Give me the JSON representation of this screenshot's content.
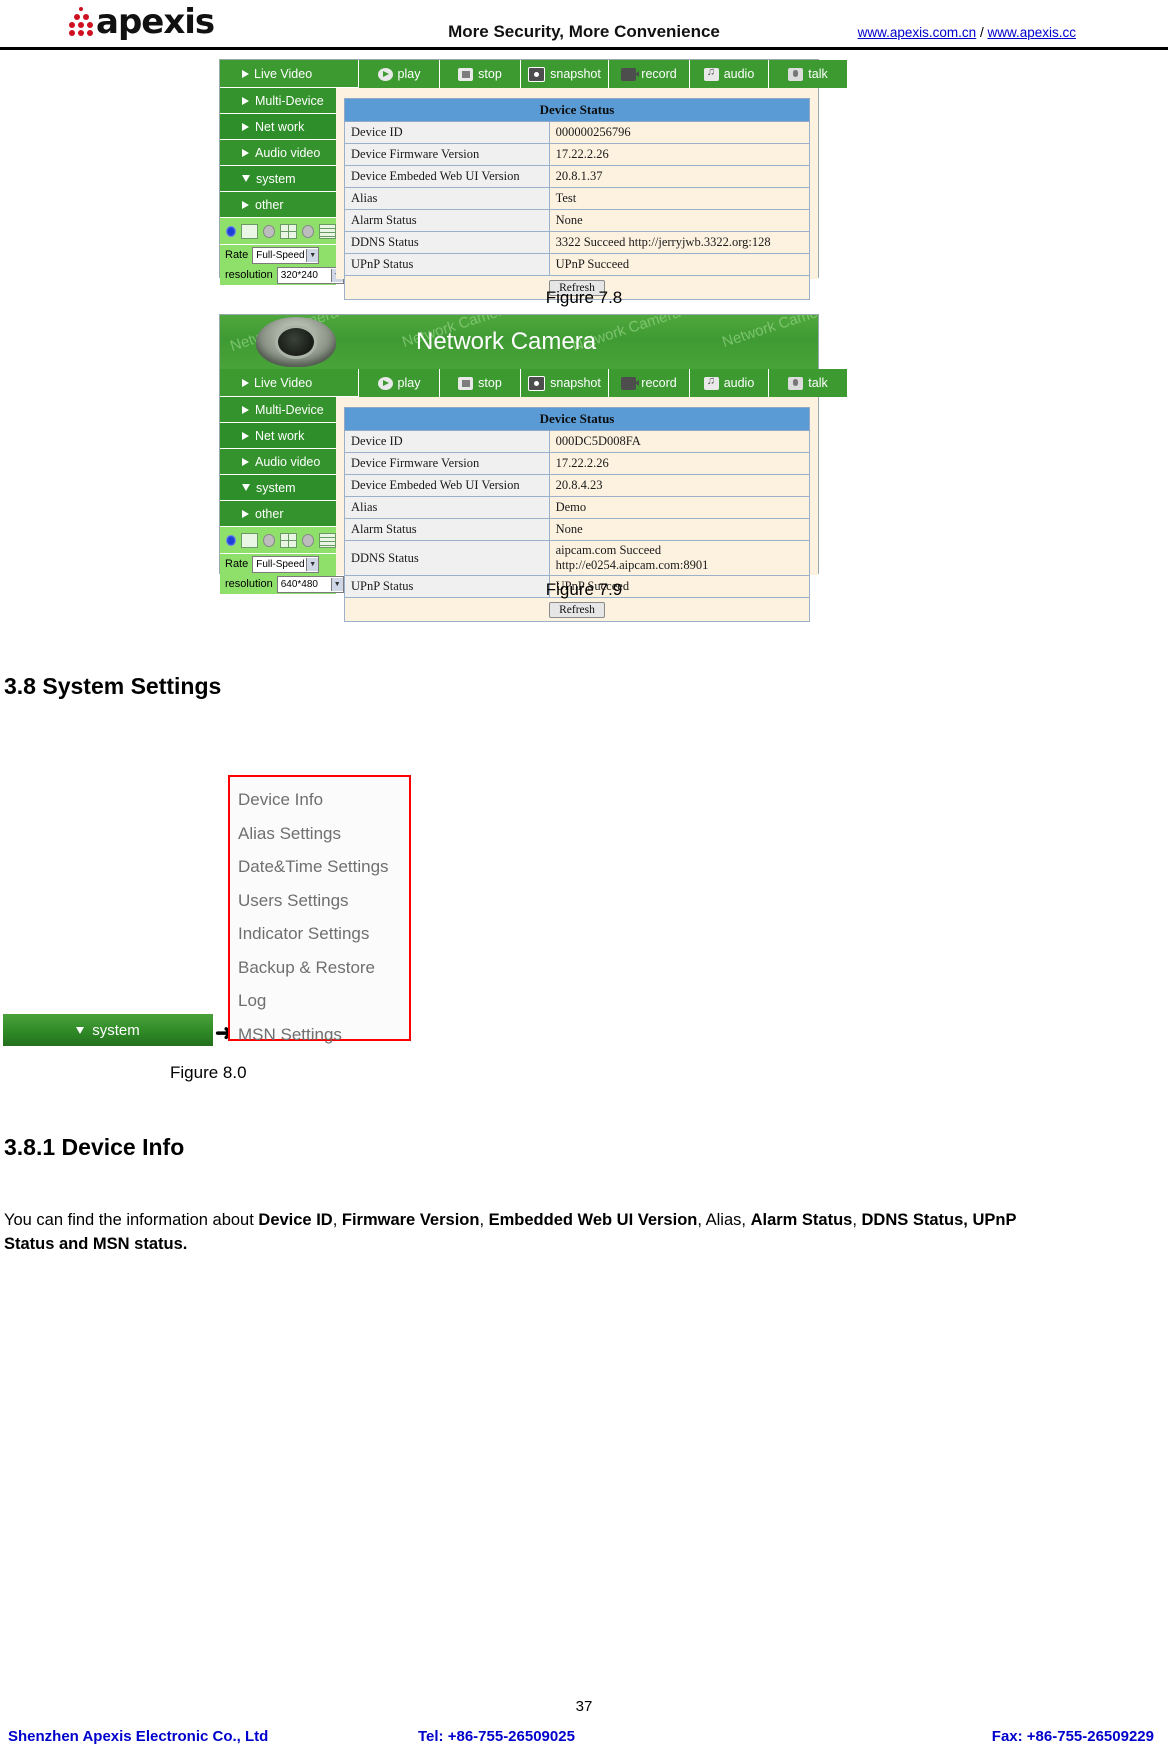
{
  "header": {
    "logo_text": "apexis",
    "tagline": "More Security, More Convenience",
    "link1": "www.apexis.com.cn",
    "separator": "/",
    "link2": "www.apexis.cc"
  },
  "figure78": {
    "caption": "Figure 7.8",
    "nav_items": [
      "Live Video",
      "Multi-Device",
      "Net work",
      "Audio video",
      "system",
      "other"
    ],
    "toolbar": [
      "play",
      "stop",
      "snapshot",
      "record",
      "audio",
      "talk"
    ],
    "rate_label": "Rate",
    "rate_value": "Full-Speed",
    "resolution_label": "resolution",
    "resolution_value": "320*240",
    "table_title": "Device Status",
    "rows": [
      {
        "key": "Device ID",
        "value": "000000256796"
      },
      {
        "key": "Device Firmware Version",
        "value": "17.22.2.26"
      },
      {
        "key": "Device Embeded Web UI Version",
        "value": "20.8.1.37"
      },
      {
        "key": "Alias",
        "value": "Test"
      },
      {
        "key": "Alarm Status",
        "value": "None"
      },
      {
        "key": "DDNS Status",
        "value": "3322 Succeed  http://jerryjwb.3322.org:128"
      },
      {
        "key": "UPnP Status",
        "value": "UPnP Succeed"
      }
    ],
    "refresh_label": "Refresh"
  },
  "figure79": {
    "caption": "Figure 7.9",
    "banner_title": "Network Camera",
    "watermark": "Network Camera",
    "nav_items": [
      "Live Video",
      "Multi-Device",
      "Net work",
      "Audio video",
      "system",
      "other"
    ],
    "toolbar": [
      "play",
      "stop",
      "snapshot",
      "record",
      "audio",
      "talk"
    ],
    "rate_label": "Rate",
    "rate_value": "Full-Speed",
    "resolution_label": "resolution",
    "resolution_value": "640*480",
    "table_title": "Device Status",
    "rows": [
      {
        "key": "Device ID",
        "value": "000DC5D008FA"
      },
      {
        "key": "Device Firmware Version",
        "value": "17.22.2.26"
      },
      {
        "key": "Device Embeded Web UI Version",
        "value": "20.8.4.23"
      },
      {
        "key": "Alias",
        "value": "Demo"
      },
      {
        "key": "Alarm Status",
        "value": "None"
      },
      {
        "key": "DDNS Status",
        "value": "aipcam.com  Succeed  http://e0254.aipcam.com:8901"
      },
      {
        "key": "UPnP Status",
        "value": "UPnP Succeed"
      }
    ],
    "refresh_label": "Refresh"
  },
  "section": {
    "heading_38": "3.8 System Settings",
    "heading_381": "3.8.1 Device Info",
    "figure80_caption": "Figure 8.0",
    "system_button_label": "system",
    "arrow_glyph": "➜",
    "menu_items": [
      "Device Info",
      "Alias Settings",
      "Date&Time Settings",
      "Users Settings",
      "Indicator Settings",
      "Backup & Restore",
      "Log",
      "MSN Settings"
    ],
    "body_part1": "You can find the information about ",
    "body_b1": "Device ID",
    "body_sep1": ", ",
    "body_b2": "Firmware Version",
    "body_sep2": ", ",
    "body_b3": "Embedded Web UI Version",
    "body_sep3": ", Alias, ",
    "body_b4": "Alarm Status",
    "body_sep4": ", ",
    "body_b5": "DDNS Status, UPnP Status and MSN status."
  },
  "footer": {
    "page_number": "37",
    "company": "Shenzhen Apexis Electronic Co., Ltd",
    "tel": "Tel: +86-755-26509025",
    "fax": "Fax: +86-755-26509229"
  }
}
